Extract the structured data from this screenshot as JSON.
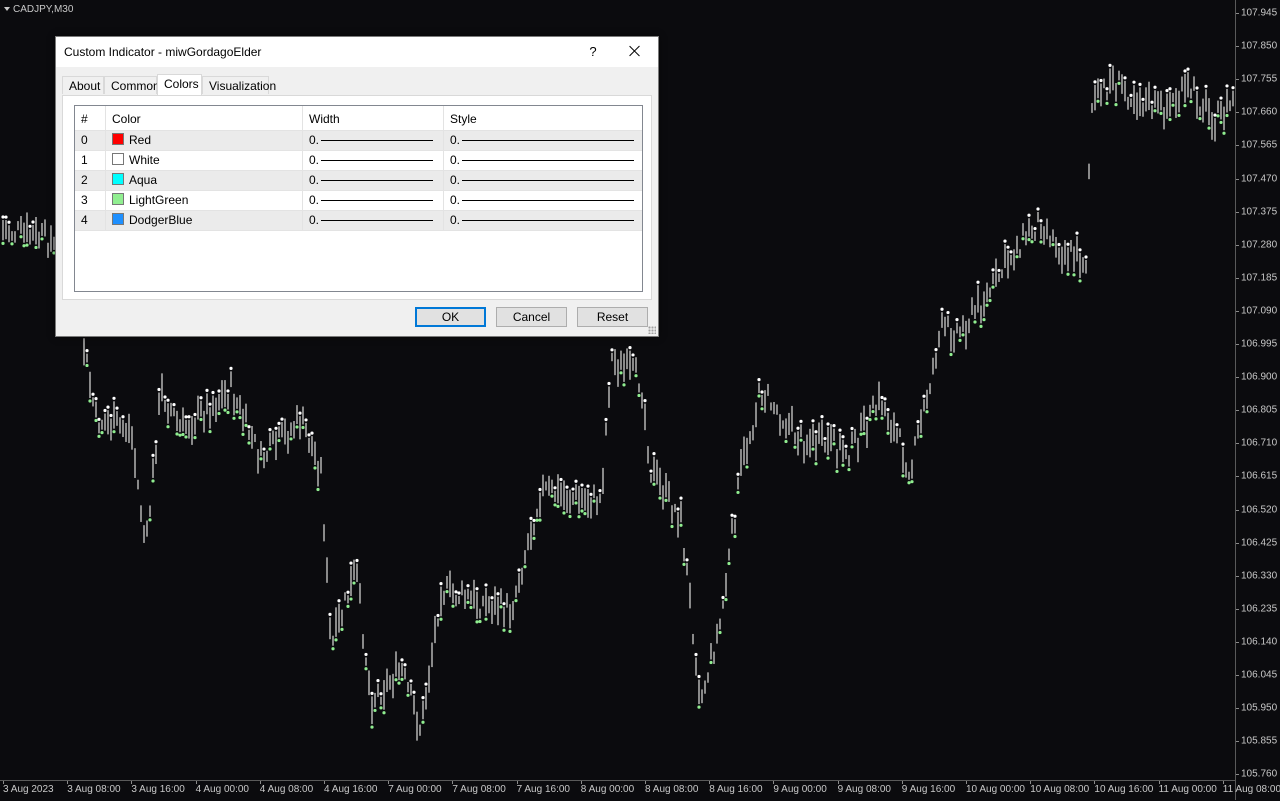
{
  "chart": {
    "symbol": "CADJPY,M30",
    "price_labels": [
      "107.945",
      "107.850",
      "107.755",
      "107.660",
      "107.565",
      "107.470",
      "107.375",
      "107.280",
      "107.185",
      "107.090",
      "106.995",
      "106.900",
      "106.805",
      "106.710",
      "106.615",
      "106.520",
      "106.425",
      "106.330",
      "106.235",
      "106.140",
      "106.045",
      "105.950",
      "105.855",
      "105.760"
    ],
    "time_labels": [
      "3 Aug 2023",
      "3 Aug 08:00",
      "3 Aug 16:00",
      "4 Aug 00:00",
      "4 Aug 08:00",
      "4 Aug 16:00",
      "7 Aug 00:00",
      "7 Aug 08:00",
      "7 Aug 16:00",
      "8 Aug 00:00",
      "8 Aug 08:00",
      "8 Aug 16:00",
      "9 Aug 00:00",
      "9 Aug 08:00",
      "9 Aug 16:00",
      "10 Aug 00:00",
      "10 Aug 08:00",
      "10 Aug 16:00",
      "11 Aug 00:00",
      "11 Aug 08:00"
    ],
    "colors": {
      "background": "#0b0b0e",
      "bar": "#8a8a8a",
      "high_dot": "#ffffff",
      "low_dot": "#90ee90"
    }
  },
  "dialog": {
    "title": "Custom Indicator - miwGordagoElder",
    "help_label": "?",
    "tabs": [
      "About",
      "Common",
      "Colors",
      "Visualization"
    ],
    "active_tab": "Colors",
    "columns": [
      "#",
      "Color",
      "Width",
      "Style"
    ],
    "rows": [
      {
        "num": "0",
        "color": "Red",
        "hex": "#ff0000",
        "width": "0.",
        "style": "0."
      },
      {
        "num": "1",
        "color": "White",
        "hex": "#ffffff",
        "width": "0.",
        "style": "0."
      },
      {
        "num": "2",
        "color": "Aqua",
        "hex": "#00ffff",
        "width": "0.",
        "style": "0."
      },
      {
        "num": "3",
        "color": "LightGreen",
        "hex": "#90ee90",
        "width": "0.",
        "style": "0."
      },
      {
        "num": "4",
        "color": "DodgerBlue",
        "hex": "#1e90ff",
        "width": "0.",
        "style": "0."
      }
    ],
    "buttons": {
      "ok": "OK",
      "cancel": "Cancel",
      "reset": "Reset"
    }
  }
}
